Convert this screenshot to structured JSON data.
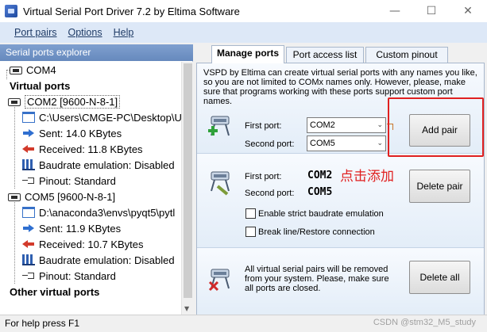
{
  "window": {
    "title": "Virtual Serial Port Driver 7.2 by Eltima Software",
    "controls": {
      "minimize": "—",
      "maximize": "☐",
      "close": "✕"
    }
  },
  "menu": {
    "items": [
      "Port pairs",
      "Options",
      "Help"
    ]
  },
  "explorer": {
    "header": "Serial ports explorer",
    "rows": [
      {
        "label": "COM4"
      },
      {
        "label": "Virtual ports"
      },
      {
        "label": "COM2 [9600-N-8-1]"
      },
      {
        "label": "C:\\Users\\CMGE-PC\\Desktop\\U"
      },
      {
        "label": "Sent: 14.0 KBytes"
      },
      {
        "label": "Received: 11.8 KBytes"
      },
      {
        "label": "Baudrate emulation: Disabled"
      },
      {
        "label": "Pinout: Standard"
      },
      {
        "label": "COM5 [9600-N-8-1]"
      },
      {
        "label": "D:\\anaconda3\\envs\\pyqt5\\pytl"
      },
      {
        "label": "Sent: 11.9 KBytes"
      },
      {
        "label": "Received: 10.7 KBytes"
      },
      {
        "label": "Baudrate emulation: Disabled"
      },
      {
        "label": "Pinout: Standard"
      },
      {
        "label": "Other virtual ports"
      }
    ]
  },
  "tabs": [
    "Manage ports",
    "Port access list",
    "Custom pinout"
  ],
  "add_pair": {
    "description": "VSPD by Eltima can create virtual serial ports with any names you like, so you are not limited to COMx names only. However, please, make sure that programs working with these ports support custom port names.",
    "first_port_label": "First port:",
    "first_port_value": "COM2",
    "second_port_label": "Second port:",
    "second_port_value": "COM5",
    "button": "Add pair"
  },
  "delete_pair": {
    "first_port_label": "First port:",
    "first_port_value": "COM2",
    "second_port_label": "Second port:",
    "second_port_value": "COM5",
    "strict_baudrate": "Enable strict baudrate emulation",
    "break_line": "Break line/Restore connection",
    "button": "Delete pair"
  },
  "delete_all": {
    "description": "All virtual serial pairs will be removed from your system. Please, make sure all ports are closed.",
    "button": "Delete all"
  },
  "annotation": "点击添加",
  "status": "For help press F1",
  "watermark": "CSDN @stm32_M5_study",
  "colors": {
    "highlight": "#e02020",
    "explorer_header": "#6f92c5",
    "menubar": "#dde8f7"
  }
}
